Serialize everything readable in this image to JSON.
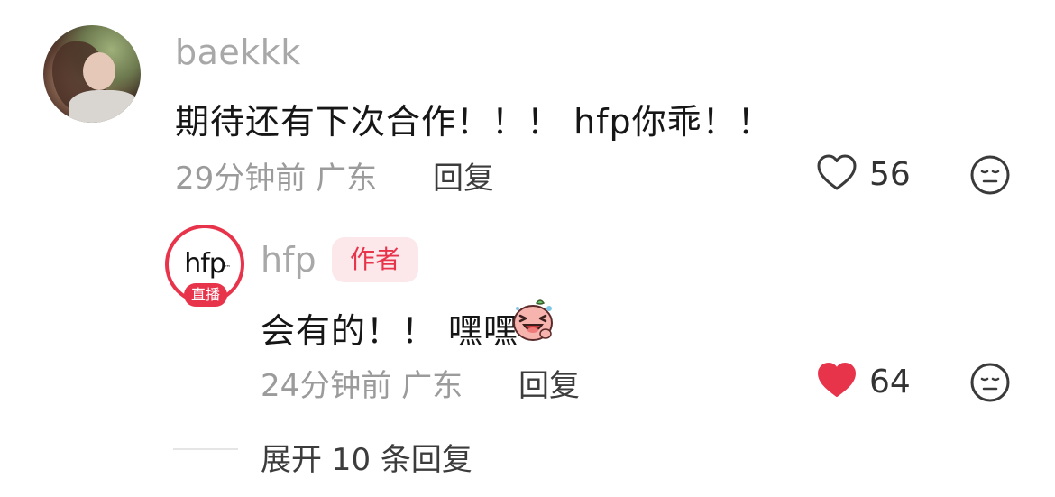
{
  "comment": {
    "username": "baekkk",
    "text": "期待还有下次合作！！！ hfp你乖！！",
    "time": "29分钟前",
    "location": "广东",
    "reply_label": "回复",
    "like_count": "56",
    "liked": false
  },
  "reply": {
    "avatar_text": "hfp",
    "avatar_tm": "™",
    "live_badge": "直播",
    "username": "hfp",
    "author_tag": "作者",
    "text": "会有的！！ 嘿嘿",
    "emoji": "laughing-face-sticker",
    "time": "24分钟前",
    "location": "广东",
    "reply_label": "回复",
    "like_count": "64",
    "liked": true
  },
  "expand_label": "展开 10 条回复",
  "colors": {
    "accent_red": "#e8344b",
    "muted_text": "#9b9b9b",
    "username": "#a8a8a8",
    "author_tag_bg": "#fce7ea"
  }
}
